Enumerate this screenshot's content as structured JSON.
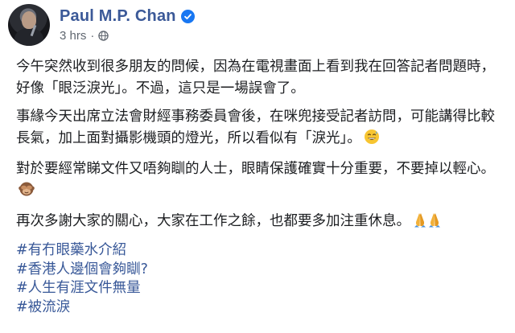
{
  "post": {
    "author_name": "Paul M.P. Chan",
    "timestamp": "3 hrs",
    "separator": "·",
    "paragraphs": [
      "今午突然收到很多朋友的問候，因為在電視畫面上看到我在回答記者問題時，好像「眼泛淚光」。不過，這只是一場誤會了。",
      "事緣今天出席立法會財經事務委員會後，在咪兜接受記者訪問，可能講得比較長氣，加上面對攝影機頭的燈光，所以看似有「淚光」。",
      "對於要經常睇文件又唔夠瞓的人士，眼睛保護確實十分重要，不要掉以輕心。",
      "再次多謝大家的關心，大家在工作之餘，也都要多加注重休息。"
    ],
    "hashtags": [
      "#有冇眼藥水介紹",
      "#香港人邊個會夠瞓?",
      "#人生有涯文件無量",
      "#被流淚"
    ],
    "icons": {
      "verified": "verified-badge-icon",
      "privacy": "globe-icon",
      "emoji_1": "grinning-sweat-emoji",
      "emoji_2": "see-no-evil-monkey-emoji",
      "emoji_3": "folded-hands-emoji"
    },
    "colors": {
      "name": "#3b5998",
      "hashtag": "#385898",
      "verified": "#1877f2",
      "meta": "#606770",
      "text": "#1c1e21"
    }
  }
}
